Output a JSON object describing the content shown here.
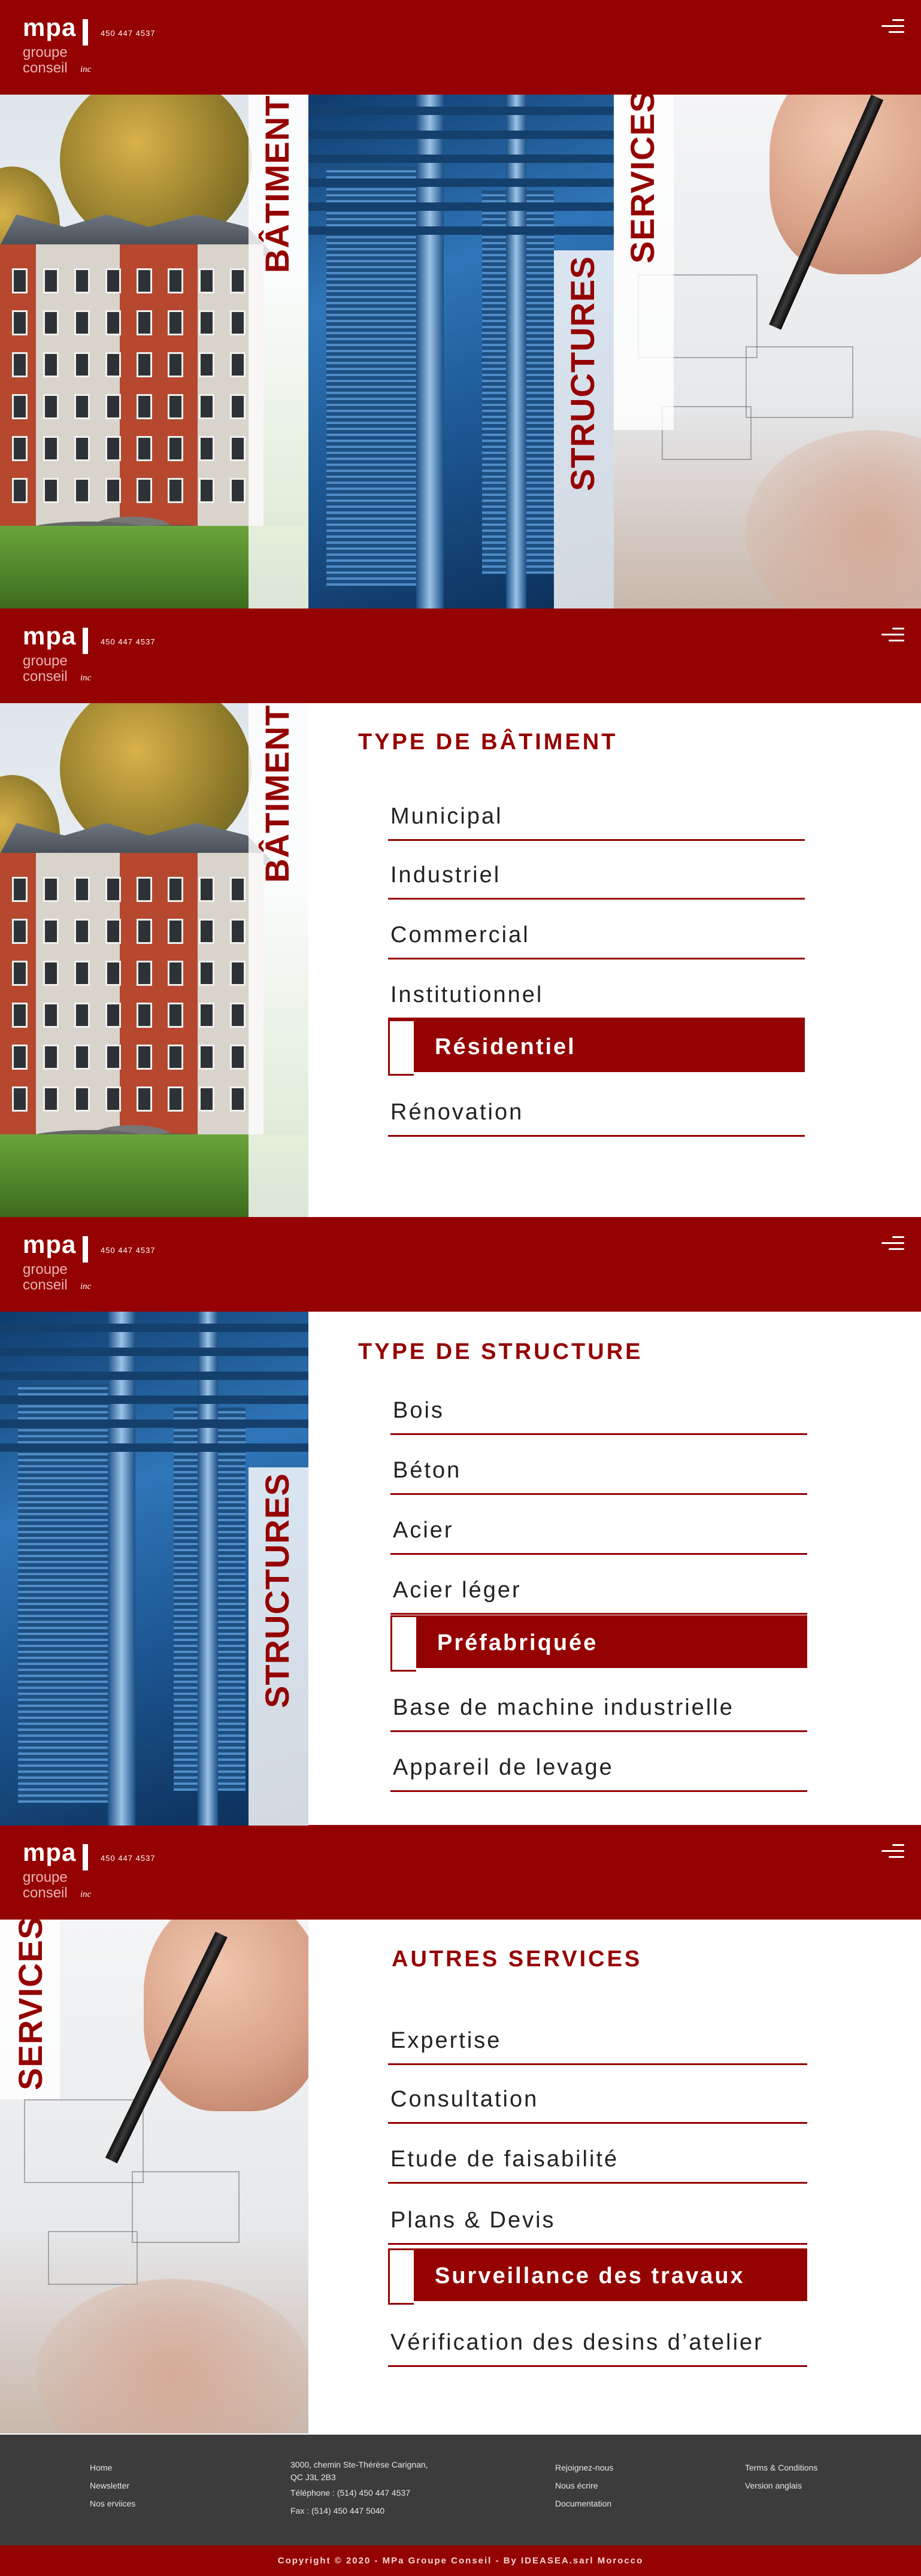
{
  "brand": {
    "logo_mpa": "mpa",
    "logo_groupe": "groupe",
    "logo_conseil": "conseil",
    "logo_inc": "inc",
    "phone": "450 447 4537",
    "color_primary": "#950202",
    "color_footer": "#3c3c3c"
  },
  "hero": {
    "label_building": "BÂTIMENT",
    "label_structures": "STRUCTURES",
    "label_services": "SERVICES"
  },
  "building": {
    "photo_label": "BÂTIMENT",
    "title": "TYPE DE BÂTIMENT",
    "items": [
      "Municipal",
      "Industriel",
      "Commercial",
      "Institutionnel",
      "Résidentiel",
      "Rénovation"
    ],
    "active_item": "Résidentiel"
  },
  "structure": {
    "photo_label": "STRUCTURES",
    "title": "TYPE DE STRUCTURE",
    "items": [
      "Bois",
      "Béton",
      "Acier",
      "Acier léger",
      "Préfabriquée",
      "Base de machine industrielle",
      "Appareil de levage"
    ],
    "active_item": "Préfabriquée"
  },
  "services": {
    "photo_label": "SERVICES",
    "title": "AUTRES SERVICES",
    "items": [
      "Expertise",
      "Consultation",
      "Etude de faisabilité",
      "Plans & Devis",
      "Surveillance des travaux",
      "Vérification des desins d’atelier"
    ],
    "active_item": "Surveillance des travaux"
  },
  "footer": {
    "col1": [
      "Home",
      "Newsletter",
      "Nos erviices"
    ],
    "col2": [
      "3000, chemin Ste-Thérèse Carignan,",
      "QC J3L 2B3",
      "Téléphone : (514) 450 447 4537",
      "Fax : (514) 450 447 5040"
    ],
    "col3": [
      "Rejoignez-nous",
      "Nous écrire",
      "Documentation"
    ],
    "col4": [
      "Terms & Conditions",
      "Version anglais"
    ],
    "copyright": "Copyright © 2020 - MPa Groupe Conseil - By IDEASEA.sarl Morocco"
  }
}
